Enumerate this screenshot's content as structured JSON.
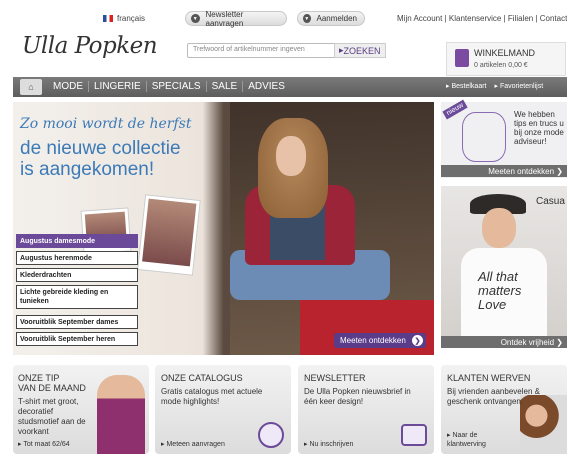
{
  "topbar": {
    "language": "français",
    "newsletter": "Newsletter aanvragen",
    "login": "Aanmelden",
    "links": "Mijn Account | Klantenservice | Filialen | Contact"
  },
  "header": {
    "logo": "Ulla Popken",
    "search_placeholder": "Trefwoord of artikelnummer ingeven",
    "search_button": "ZOEKEN",
    "cart_label": "WINKELMAND",
    "cart_summary": "0 artikelen    0,00 €"
  },
  "nav": {
    "items": [
      "MODE",
      "LINGERIE",
      "SPECIALS",
      "SALE",
      "ADVIES"
    ],
    "right": [
      "Bestelkaart",
      "Favorietenlijst"
    ]
  },
  "hero": {
    "tagline": "Zo mooi wordt de herfst",
    "headline_1": "de nieuwe collectie",
    "headline_2": "is aangekomen!",
    "links": [
      "Augustus damesmode",
      "Augustus herenmode",
      "Klederdrachten",
      "Lichte gebreide kleding en tunieken",
      "Vooruitblik September dames",
      "Vooruitblik September heren"
    ],
    "cta": "Meeten ontdekken"
  },
  "promos": {
    "p1_badge": "nieuw",
    "p1_text": "We hebben tips en trucs u bij onze mode adviseur!",
    "p1_cta": "Meeten ontdekken",
    "p2_title": "Casua",
    "p2_cta": "Ontdek vrijheid",
    "p2_shirt": "All that matters Love"
  },
  "tiles": [
    {
      "title": "ONZE TIP\nVAN DE MAAND",
      "text": "T-shirt met groot, decoratief studsmotief aan de voorkant",
      "link": "Tot maat 62/64"
    },
    {
      "title": "ONZE CATALOGUS",
      "text": "Gratis catalogus met actuele mode highlights!",
      "link": "Meteen aanvragen"
    },
    {
      "title": "NEWSLETTER",
      "text": "De Ulla Popken nieuwsbrief in één keer design!",
      "link": "Nu inschrijven"
    },
    {
      "title": "KLANTEN WERVEN",
      "text": "Bij vrienden aanbevelen & geschenk ontvangen.",
      "link": "Naar de klantwerving"
    }
  ],
  "colors": {
    "accent": "#5a3c8a",
    "hero_text": "#3c7ab8",
    "nav": "#666666"
  }
}
